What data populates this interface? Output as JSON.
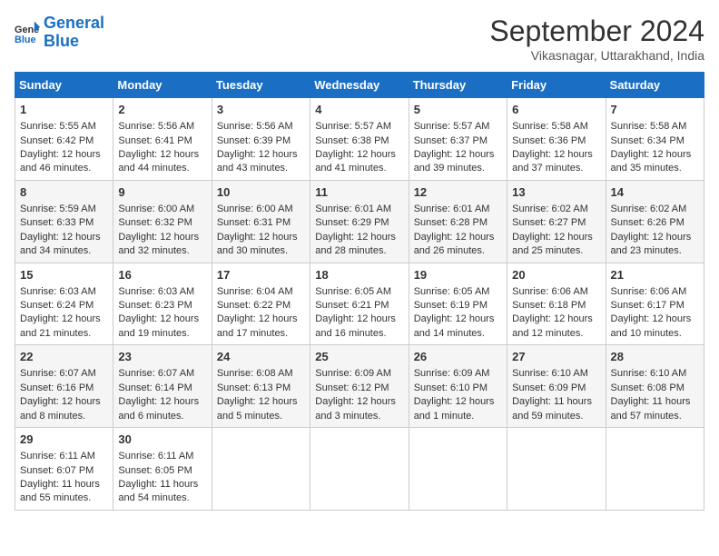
{
  "header": {
    "logo_line1": "General",
    "logo_line2": "Blue",
    "month": "September 2024",
    "location": "Vikasnagar, Uttarakhand, India"
  },
  "days_of_week": [
    "Sunday",
    "Monday",
    "Tuesday",
    "Wednesday",
    "Thursday",
    "Friday",
    "Saturday"
  ],
  "weeks": [
    [
      {
        "day": 1,
        "info": "Sunrise: 5:55 AM\nSunset: 6:42 PM\nDaylight: 12 hours and 46 minutes."
      },
      {
        "day": 2,
        "info": "Sunrise: 5:56 AM\nSunset: 6:41 PM\nDaylight: 12 hours and 44 minutes."
      },
      {
        "day": 3,
        "info": "Sunrise: 5:56 AM\nSunset: 6:39 PM\nDaylight: 12 hours and 43 minutes."
      },
      {
        "day": 4,
        "info": "Sunrise: 5:57 AM\nSunset: 6:38 PM\nDaylight: 12 hours and 41 minutes."
      },
      {
        "day": 5,
        "info": "Sunrise: 5:57 AM\nSunset: 6:37 PM\nDaylight: 12 hours and 39 minutes."
      },
      {
        "day": 6,
        "info": "Sunrise: 5:58 AM\nSunset: 6:36 PM\nDaylight: 12 hours and 37 minutes."
      },
      {
        "day": 7,
        "info": "Sunrise: 5:58 AM\nSunset: 6:34 PM\nDaylight: 12 hours and 35 minutes."
      }
    ],
    [
      {
        "day": 8,
        "info": "Sunrise: 5:59 AM\nSunset: 6:33 PM\nDaylight: 12 hours and 34 minutes."
      },
      {
        "day": 9,
        "info": "Sunrise: 6:00 AM\nSunset: 6:32 PM\nDaylight: 12 hours and 32 minutes."
      },
      {
        "day": 10,
        "info": "Sunrise: 6:00 AM\nSunset: 6:31 PM\nDaylight: 12 hours and 30 minutes."
      },
      {
        "day": 11,
        "info": "Sunrise: 6:01 AM\nSunset: 6:29 PM\nDaylight: 12 hours and 28 minutes."
      },
      {
        "day": 12,
        "info": "Sunrise: 6:01 AM\nSunset: 6:28 PM\nDaylight: 12 hours and 26 minutes."
      },
      {
        "day": 13,
        "info": "Sunrise: 6:02 AM\nSunset: 6:27 PM\nDaylight: 12 hours and 25 minutes."
      },
      {
        "day": 14,
        "info": "Sunrise: 6:02 AM\nSunset: 6:26 PM\nDaylight: 12 hours and 23 minutes."
      }
    ],
    [
      {
        "day": 15,
        "info": "Sunrise: 6:03 AM\nSunset: 6:24 PM\nDaylight: 12 hours and 21 minutes."
      },
      {
        "day": 16,
        "info": "Sunrise: 6:03 AM\nSunset: 6:23 PM\nDaylight: 12 hours and 19 minutes."
      },
      {
        "day": 17,
        "info": "Sunrise: 6:04 AM\nSunset: 6:22 PM\nDaylight: 12 hours and 17 minutes."
      },
      {
        "day": 18,
        "info": "Sunrise: 6:05 AM\nSunset: 6:21 PM\nDaylight: 12 hours and 16 minutes."
      },
      {
        "day": 19,
        "info": "Sunrise: 6:05 AM\nSunset: 6:19 PM\nDaylight: 12 hours and 14 minutes."
      },
      {
        "day": 20,
        "info": "Sunrise: 6:06 AM\nSunset: 6:18 PM\nDaylight: 12 hours and 12 minutes."
      },
      {
        "day": 21,
        "info": "Sunrise: 6:06 AM\nSunset: 6:17 PM\nDaylight: 12 hours and 10 minutes."
      }
    ],
    [
      {
        "day": 22,
        "info": "Sunrise: 6:07 AM\nSunset: 6:16 PM\nDaylight: 12 hours and 8 minutes."
      },
      {
        "day": 23,
        "info": "Sunrise: 6:07 AM\nSunset: 6:14 PM\nDaylight: 12 hours and 6 minutes."
      },
      {
        "day": 24,
        "info": "Sunrise: 6:08 AM\nSunset: 6:13 PM\nDaylight: 12 hours and 5 minutes."
      },
      {
        "day": 25,
        "info": "Sunrise: 6:09 AM\nSunset: 6:12 PM\nDaylight: 12 hours and 3 minutes."
      },
      {
        "day": 26,
        "info": "Sunrise: 6:09 AM\nSunset: 6:10 PM\nDaylight: 12 hours and 1 minute."
      },
      {
        "day": 27,
        "info": "Sunrise: 6:10 AM\nSunset: 6:09 PM\nDaylight: 11 hours and 59 minutes."
      },
      {
        "day": 28,
        "info": "Sunrise: 6:10 AM\nSunset: 6:08 PM\nDaylight: 11 hours and 57 minutes."
      }
    ],
    [
      {
        "day": 29,
        "info": "Sunrise: 6:11 AM\nSunset: 6:07 PM\nDaylight: 11 hours and 55 minutes."
      },
      {
        "day": 30,
        "info": "Sunrise: 6:11 AM\nSunset: 6:05 PM\nDaylight: 11 hours and 54 minutes."
      },
      {
        "day": null,
        "info": ""
      },
      {
        "day": null,
        "info": ""
      },
      {
        "day": null,
        "info": ""
      },
      {
        "day": null,
        "info": ""
      },
      {
        "day": null,
        "info": ""
      }
    ]
  ]
}
